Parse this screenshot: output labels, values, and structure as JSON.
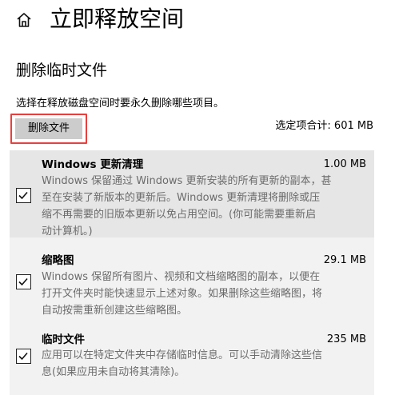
{
  "header": {
    "home_icon": "home-icon",
    "title": "立即释放空间"
  },
  "section": {
    "title": "删除临时文件",
    "instruction": "选择在释放磁盘空间时要永久删除哪些项目。",
    "delete_button_label": "删除文件",
    "selected_total": "选定项合计: 601 MB"
  },
  "items": [
    {
      "name": "Windows 更新清理",
      "size": "1.00 MB",
      "checked": true,
      "description": "Windows 保留通过 Windows 更新安装的所有更新的副本，甚\n至在安装了新版本的更新后。Windows 更新清理将删除或压\n缩不再需要的旧版本更新以免占用空间。(你可能需要重新启\n动计算机。)"
    },
    {
      "name": "缩略图",
      "size": "29.1 MB",
      "checked": true,
      "description": "Windows 保留所有图片、视频和文档缩略图的副本，以便在\n打开文件夹时能快速显示上述对象。如果删除这些缩略图，将\n自动按需重新创建这些缩略图。"
    },
    {
      "name": "临时文件",
      "size": "235 MB",
      "checked": true,
      "description": "应用可以在特定文件夹中存储临时信息。可以手动清除这些信\n息(如果应用未自动将其清除)。"
    }
  ],
  "colors": {
    "highlight_border": "#e8403e",
    "button_bg": "#cccccc",
    "list_bg": "#f2f2f2",
    "description_text": "#6b6b6b"
  }
}
